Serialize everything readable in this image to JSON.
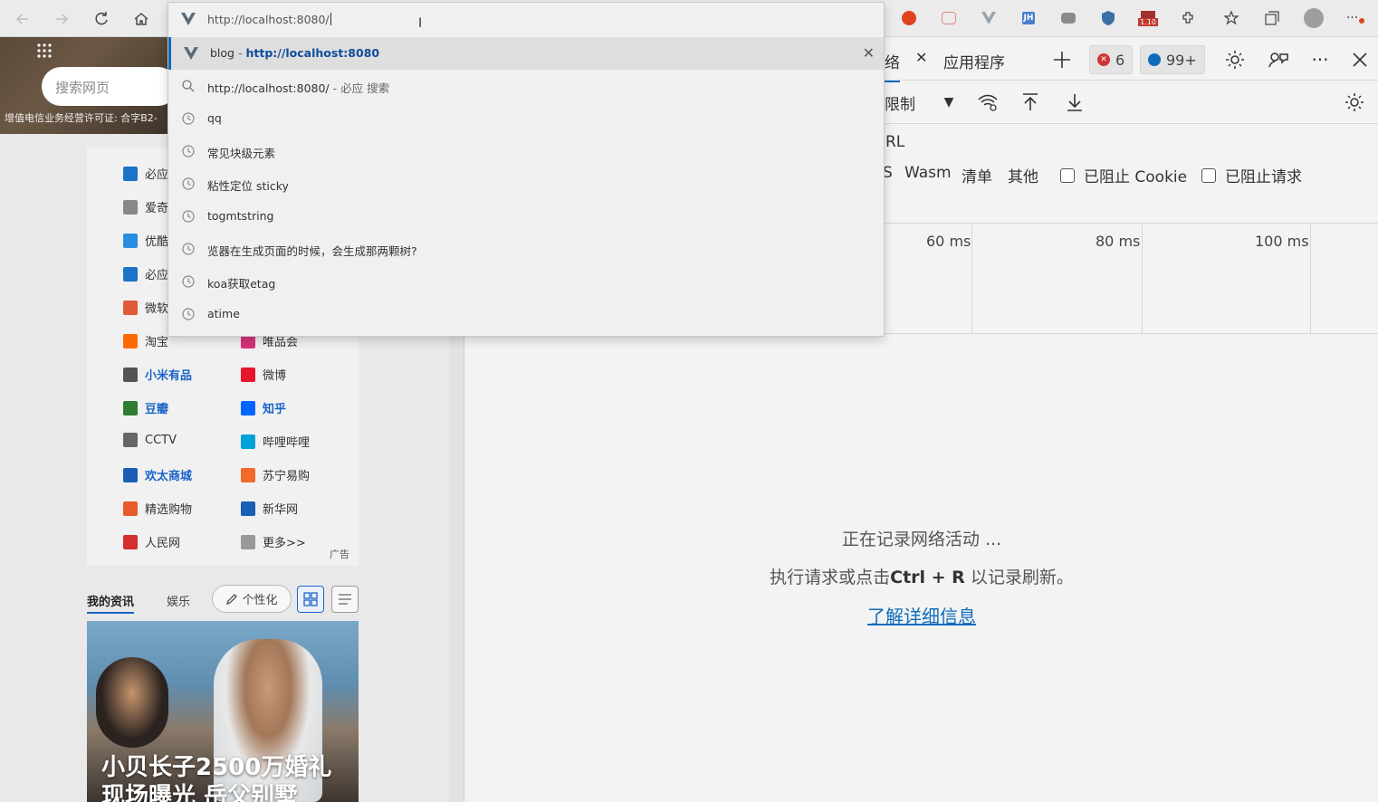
{
  "browser": {
    "address_value": "http://localhost:8080/",
    "ext_badge": "1.10",
    "suggestions": [
      {
        "type": "site",
        "title": "blog",
        "sep": " - ",
        "url": "http://localhost:8080"
      },
      {
        "type": "search",
        "title": "http://localhost:8080/",
        "suffix": " - 必应 搜索"
      },
      {
        "type": "history",
        "title": "qq"
      },
      {
        "type": "history",
        "title": "常见块级元素"
      },
      {
        "type": "history",
        "title": "粘性定位 sticky"
      },
      {
        "type": "history",
        "title": "togmtstring"
      },
      {
        "type": "history",
        "title": "览器在生成页面的时候，会生成那两颗树?"
      },
      {
        "type": "history",
        "title": "koa获取etag"
      },
      {
        "type": "history",
        "title": "atime"
      }
    ]
  },
  "newtab": {
    "search_placeholder": "搜索网页",
    "license": "增值电信业务经营许可证: 合字B2-",
    "links": [
      {
        "label": "必应",
        "icon": "bing-icon",
        "color": "#1a73c8"
      },
      {
        "label": "爱奇",
        "icon": "iqiyi-icon",
        "color": "#888888"
      },
      {
        "label": "优酷",
        "icon": "youku-icon",
        "color": "#2a8ee0"
      },
      {
        "label": "必应",
        "icon": "bing-icon",
        "color": "#1a73c8"
      },
      {
        "label": "微软",
        "icon": "msn-icon",
        "color": "#e05a3a"
      },
      {
        "label": "淘宝",
        "icon": "taobao-icon",
        "color": "#ff6a00"
      },
      {
        "label": "唯品会",
        "icon": "vip-icon",
        "color": "#d6327a"
      },
      {
        "label": "小米有品",
        "icon": "xiaomi-icon",
        "color": "#555555",
        "bold": true
      },
      {
        "label": "微博",
        "icon": "weibo-icon",
        "color": "#e6162d"
      },
      {
        "label": "豆瓣",
        "icon": "douban-icon",
        "color": "#2e7d32",
        "bold": true
      },
      {
        "label": "知乎",
        "icon": "zhihu-icon",
        "color": "#0066ff",
        "bold": true
      },
      {
        "label": "CCTV",
        "icon": "cctv-icon",
        "color": "#666666"
      },
      {
        "label": "哔哩哔哩",
        "icon": "bilibili-icon",
        "color": "#00a1d6"
      },
      {
        "label": "欢太商城",
        "icon": "heytap-icon",
        "color": "#1a5fb4",
        "bold": true
      },
      {
        "label": "苏宁易购",
        "icon": "suning-icon",
        "color": "#f06a2a"
      },
      {
        "label": "精选购物",
        "icon": "shopping-icon",
        "color": "#e85a2a"
      },
      {
        "label": "新华网",
        "icon": "xinhua-icon",
        "color": "#1a5fb4"
      },
      {
        "label": "人民网",
        "icon": "people-icon",
        "color": "#d32f2f"
      },
      {
        "label": "更多>>",
        "icon": "more-icon",
        "color": "#999999"
      }
    ],
    "ad_label": "广告",
    "feed_tab_my": "我的资讯",
    "feed_tab_ent": "娱乐",
    "personalize": "个性化",
    "news_title_line1": "小贝长子2500万婚礼",
    "news_title_line2": "现场曝光  岳父别墅"
  },
  "devtools": {
    "tab_network_fragment": "络",
    "tab_application": "应用程序",
    "error_count": "6",
    "message_count": "99+",
    "throttle_fragment": "限制",
    "url_fragment": "RL",
    "filters": [
      "S",
      "Wasm",
      "清单",
      "其他"
    ],
    "blocked_cookies": "已阻止 Cookie",
    "blocked_requests": "已阻止请求",
    "ticks": [
      "60 ms",
      "80 ms",
      "100 ms"
    ],
    "recording": "正在记录网络活动 ...",
    "hint_prefix": "执行请求或点击",
    "hint_key": "Ctrl + R",
    "hint_suffix": " 以记录刷新。",
    "learn_more": "了解详细信息"
  }
}
